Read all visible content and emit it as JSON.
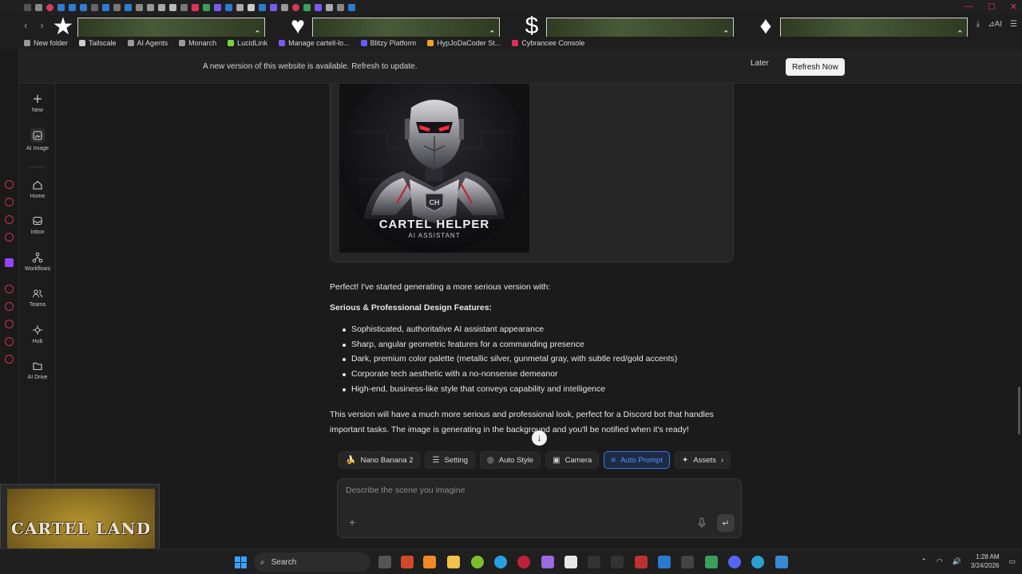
{
  "browser": {
    "bookmarks": [
      {
        "label": "New folder",
        "color": "#9a9a9a"
      },
      {
        "label": "Tailscale",
        "color": "#cccccc"
      },
      {
        "label": "AI Agents",
        "color": "#9a9a9a"
      },
      {
        "label": "Monarch",
        "color": "#9a9a9a"
      },
      {
        "label": "LucidLink",
        "color": "#7ad33a"
      },
      {
        "label": "Manage cartell-lo...",
        "color": "#7a5af0"
      },
      {
        "label": "Blitzy Platform",
        "color": "#6b5bff"
      },
      {
        "label": "HypJoDaCoder St...",
        "color": "#f0a020"
      },
      {
        "label": "Cybrancee Console",
        "color": "#e03060"
      }
    ],
    "ai_label": "AI"
  },
  "banner": {
    "text": "A new version of this website is available. Refresh to update.",
    "later_label": "Later",
    "refresh_label": "Refresh Now"
  },
  "sidebar": {
    "items": [
      {
        "label": "New",
        "icon": "plus-icon"
      },
      {
        "label": "AI Image",
        "icon": "image-edit-icon"
      },
      {
        "label": "Home",
        "icon": "home-icon"
      },
      {
        "label": "Inbox",
        "icon": "inbox-icon"
      },
      {
        "label": "Workflows",
        "icon": "workflow-icon"
      },
      {
        "label": "Teams",
        "icon": "users-icon"
      },
      {
        "label": "Hub",
        "icon": "hub-icon"
      },
      {
        "label": "AI Drive",
        "icon": "drive-icon"
      }
    ]
  },
  "image": {
    "title": "CARTEL HELPER",
    "subtitle": "AI ASSISTANT"
  },
  "chat": {
    "intro": "Perfect! I've started generating a more serious version with:",
    "heading": "Serious & Professional Design Features:",
    "features": [
      "Sophisticated, authoritative AI assistant appearance",
      "Sharp, angular geometric features for a commanding presence",
      "Dark, premium color palette (metallic silver, gunmetal gray, with subtle red/gold accents)",
      "Corporate tech aesthetic with a no-nonsense demeanor",
      "High-end, business-like style that conveys capability and intelligence"
    ],
    "outro": "This version will have a much more serious and professional look, perfect for a Discord bot that handles important tasks. The image is generating in the background and you'll be notified when it's ready!"
  },
  "toolbar": {
    "model": "Nano Banana 2",
    "setting": "Setting",
    "auto_style": "Auto Style",
    "camera": "Camera",
    "auto_prompt": "Auto Prompt",
    "assets": "Assets"
  },
  "prompt": {
    "placeholder": "Describe the scene you imagine"
  },
  "overlay": {
    "title": "CARTEL LAND"
  },
  "taskbar": {
    "search_label": "Search",
    "time": "1:28 AM",
    "date": "3/24/2026"
  },
  "colors": {
    "accent": "#3b7bf0",
    "brand_red": "#d93a5b"
  }
}
